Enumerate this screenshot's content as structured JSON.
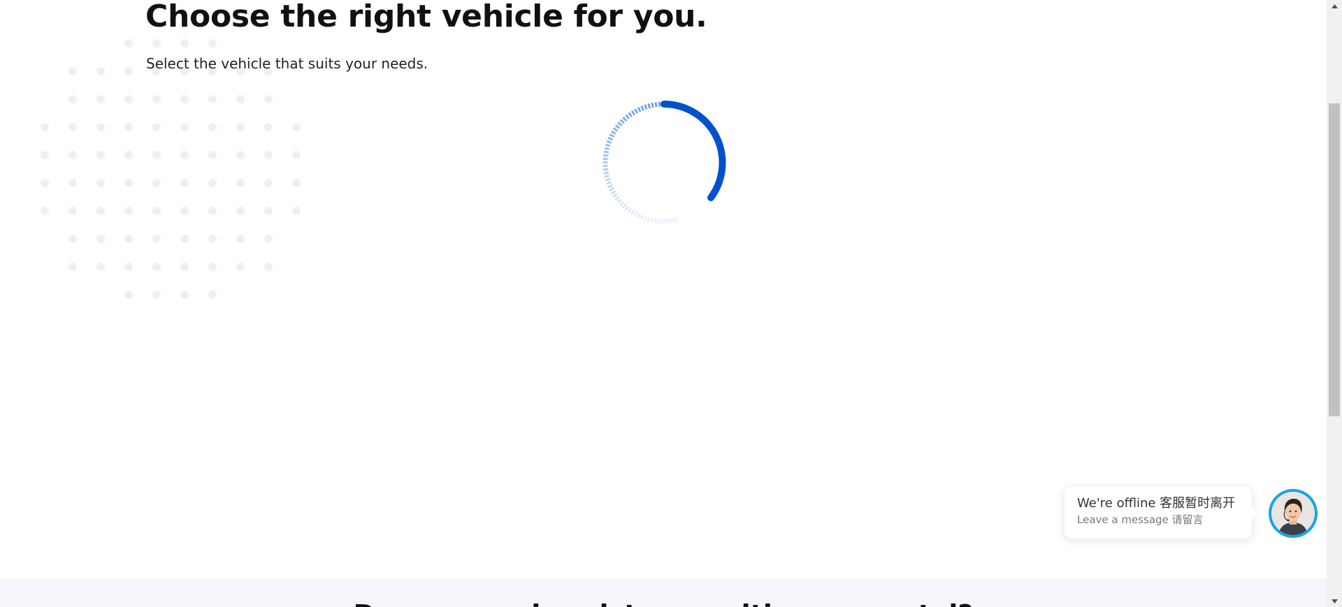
{
  "main": {
    "title": "Choose the right vehicle for you.",
    "subtitle": "Select the vehicle that suits your needs."
  },
  "loading": {
    "icon": "loading-spinner",
    "color": "#0052cc"
  },
  "bottom_section": {
    "heading": "Do you need assistance with your rental?"
  },
  "chat_widget": {
    "status": "We're offline 客服暂时离开",
    "action": "Leave a message 请留言",
    "avatar_icon": "support-agent-avatar",
    "ring_color": "#1aa3e8"
  },
  "colors": {
    "accent": "#0052cc",
    "dots": "#edf0f8",
    "section_bg": "#f4f6fb"
  }
}
